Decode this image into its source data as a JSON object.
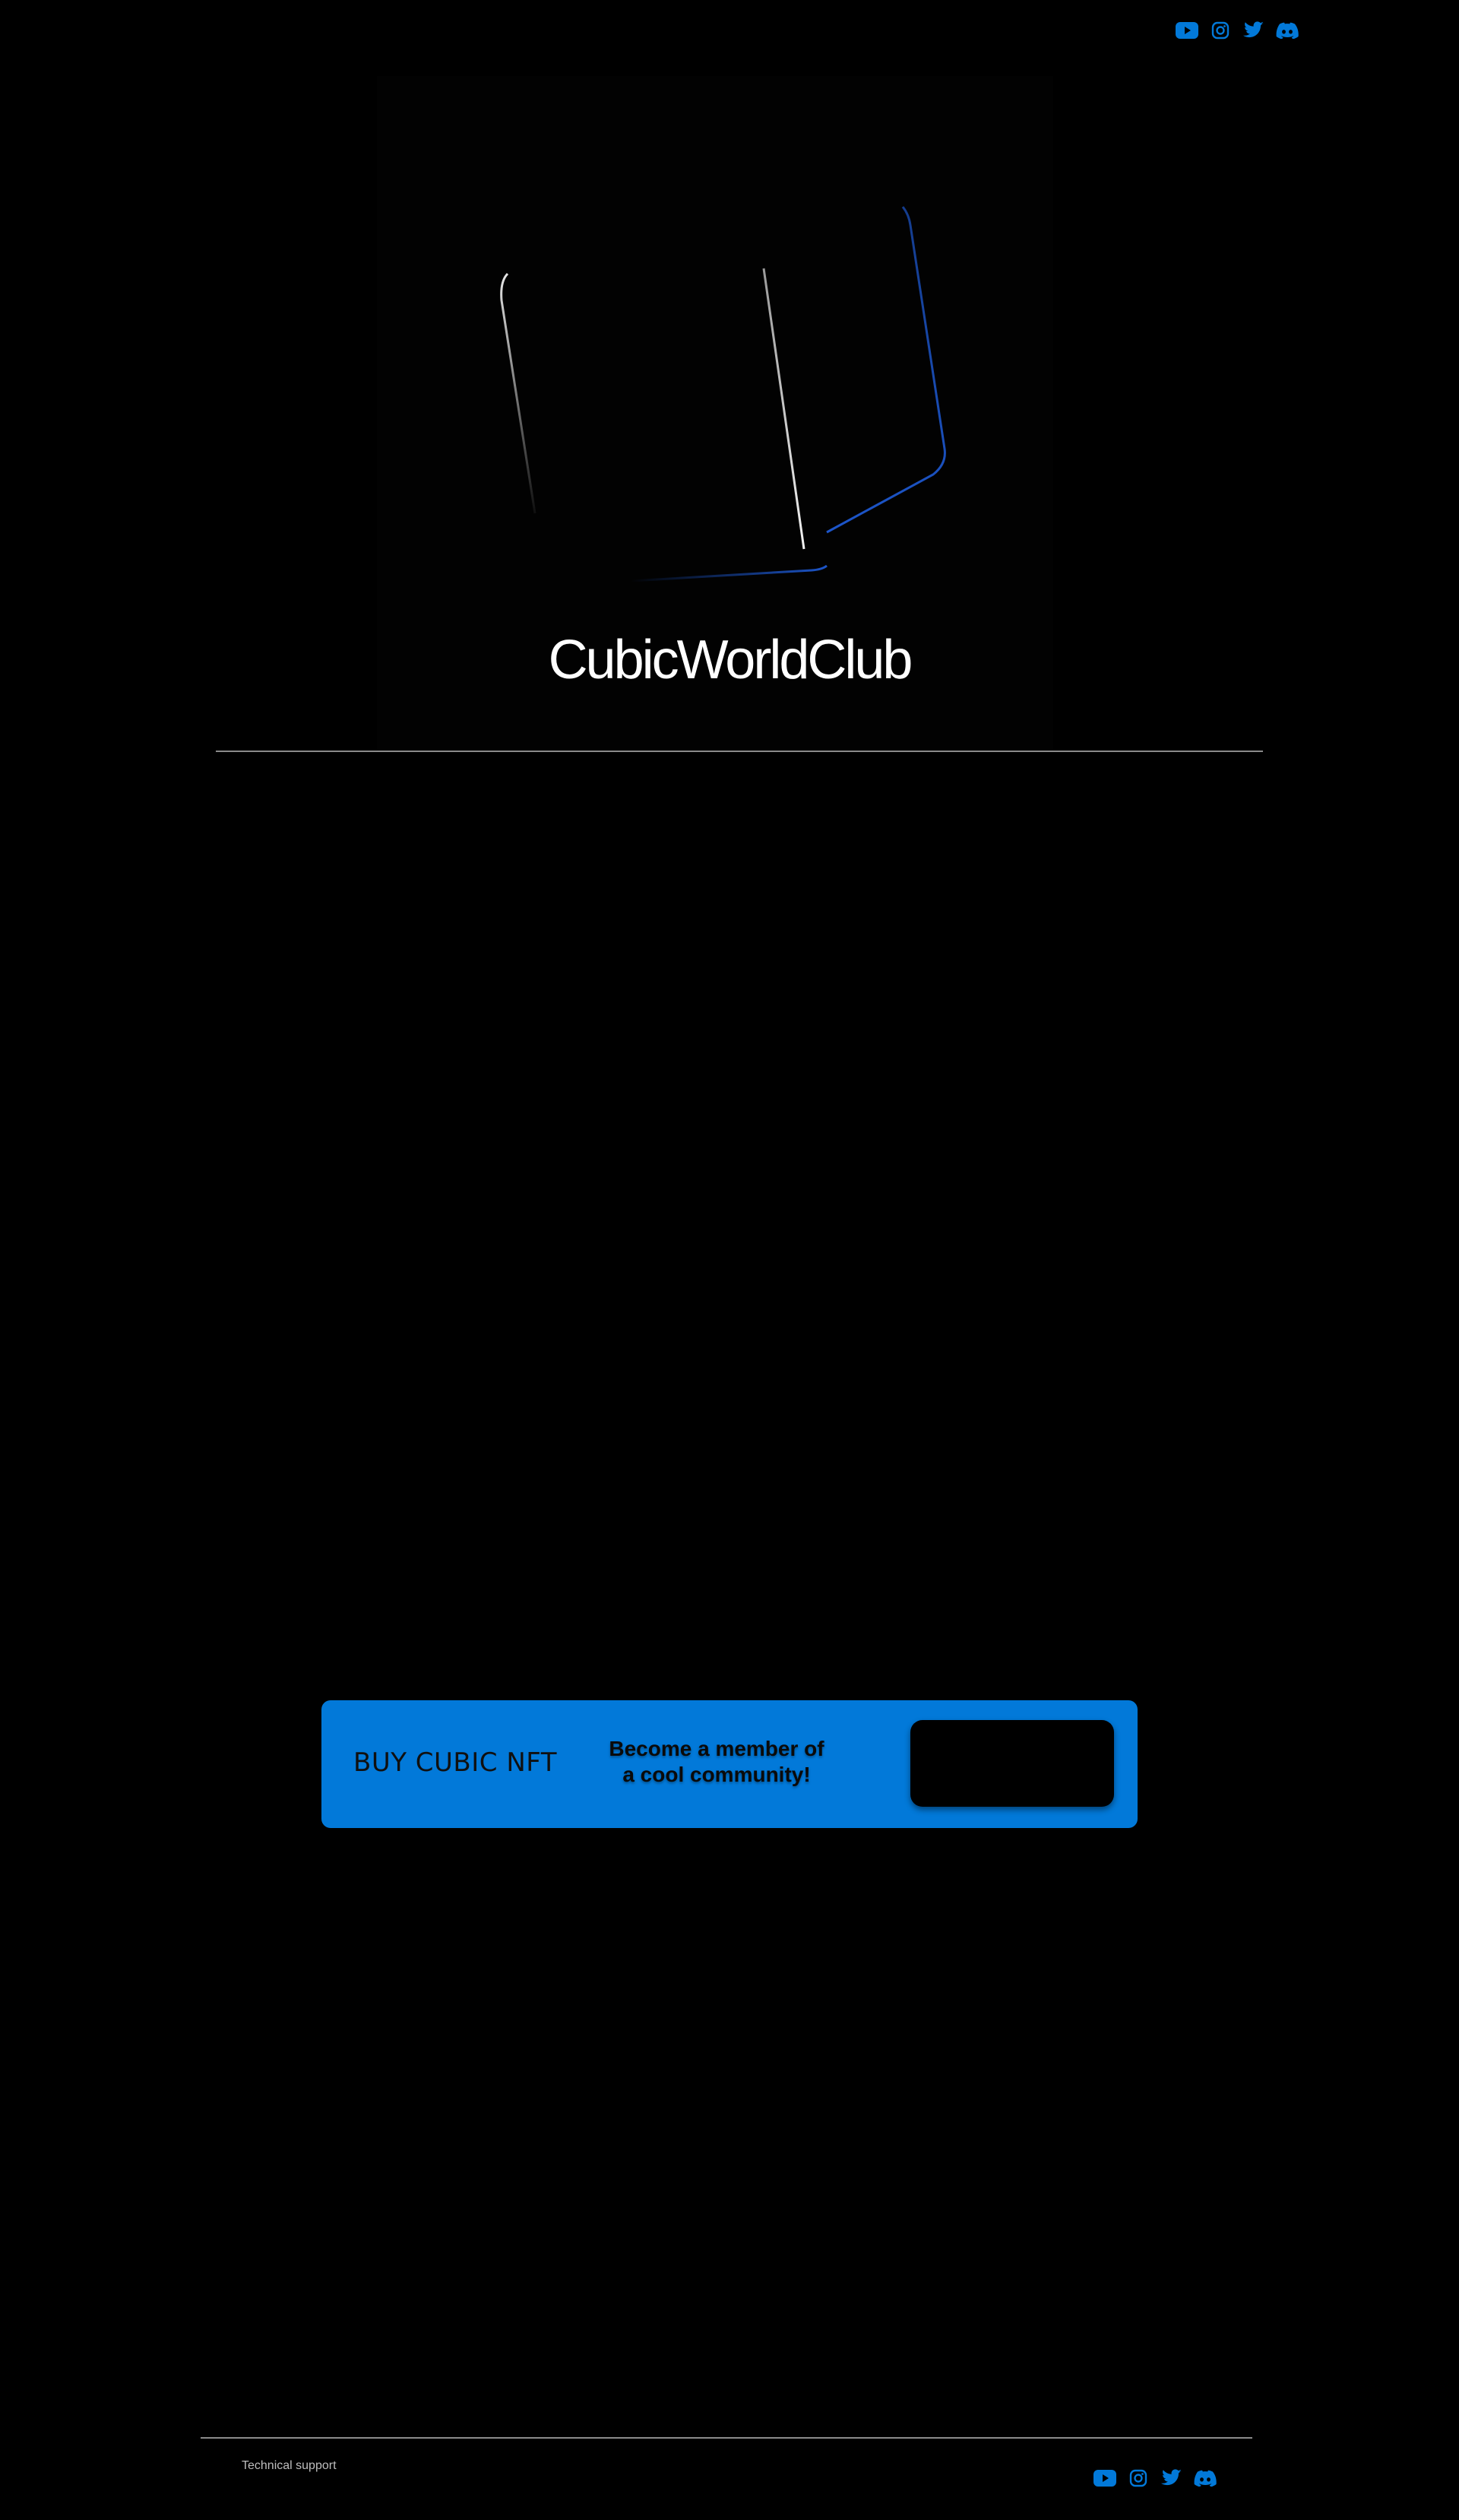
{
  "header": {
    "social_icons": [
      {
        "icon": "youtube-icon"
      },
      {
        "icon": "instagram-icon"
      },
      {
        "icon": "twitter-icon"
      },
      {
        "icon": "discord-icon"
      }
    ]
  },
  "hero": {
    "title": "CubicWorldClub"
  },
  "cta": {
    "title": "BUY CUBIC NFT",
    "subtitle_line1": "Become a member of",
    "subtitle_line2": "a cool community!",
    "button_label": ""
  },
  "footer": {
    "support_link": "Technical support",
    "social_icons": [
      {
        "icon": "youtube-icon"
      },
      {
        "icon": "instagram-icon"
      },
      {
        "icon": "twitter-icon"
      },
      {
        "icon": "discord-icon"
      }
    ]
  },
  "colors": {
    "background": "#000000",
    "accent": "#0279d9",
    "divider": "#8a8a8a",
    "text": "#ffffff"
  }
}
